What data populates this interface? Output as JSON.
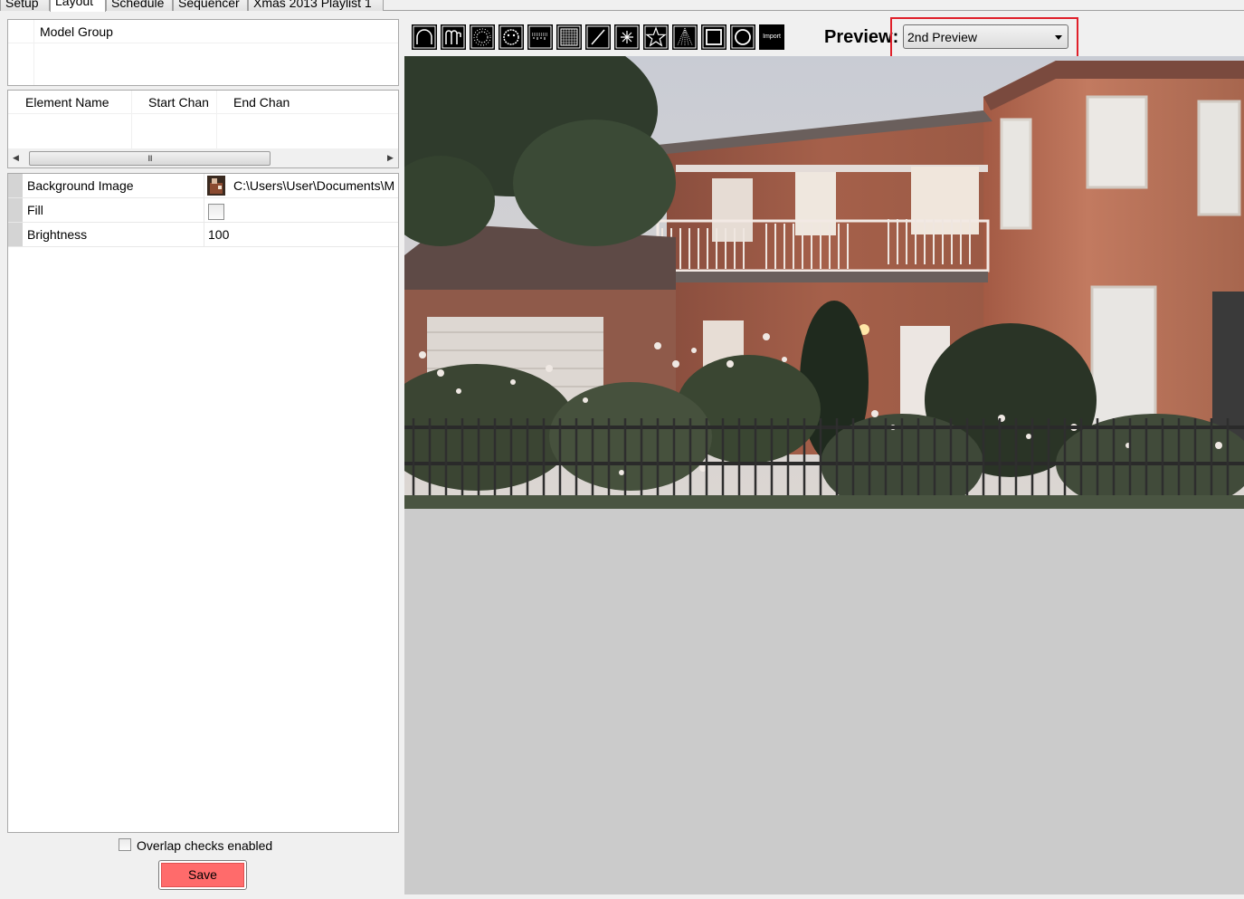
{
  "tabs": [
    {
      "label": "Setup",
      "active": false
    },
    {
      "label": "Layout",
      "active": true
    },
    {
      "label": "Schedule",
      "active": false
    },
    {
      "label": "Sequencer",
      "active": false
    },
    {
      "label": "Xmas 2013 Playlist 1",
      "active": false
    }
  ],
  "model_group": {
    "header": "Model Group"
  },
  "elements": {
    "columns": [
      "Element Name",
      "Start Chan",
      "End Chan"
    ],
    "scroll_grip": "III"
  },
  "properties": [
    {
      "name": "Background Image",
      "value": "C:\\Users\\User\\Documents\\M",
      "type": "image-path"
    },
    {
      "name": "Fill",
      "value": "",
      "type": "checkbox",
      "checked": false
    },
    {
      "name": "Brightness",
      "value": "100",
      "type": "text"
    }
  ],
  "overlap": {
    "label": "Overlap checks enabled",
    "checked": false
  },
  "save": {
    "label": "Save",
    "color": "#ff6b6b"
  },
  "toolbar": {
    "tools": [
      "arch-icon",
      "candy-cane-icon",
      "spinner-icon",
      "wreath-icon",
      "icicles-icon",
      "matrix-icon",
      "single-line-icon",
      "starburst-icon",
      "star-icon",
      "tree-icon",
      "rectangle-icon",
      "circle-icon",
      "import-icon"
    ],
    "import_label": "Import"
  },
  "preview": {
    "label": "Preview:",
    "selected": "2nd Preview",
    "highlight_color": "#e0202a"
  },
  "canvas": {
    "background_color": "#cbcbcb"
  }
}
